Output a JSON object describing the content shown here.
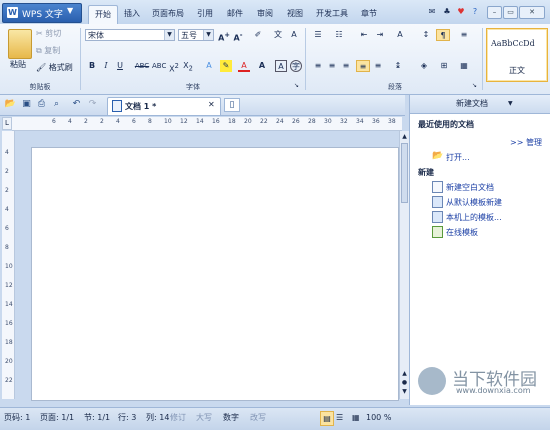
{
  "app": {
    "name": "WPS 文字",
    "logo": "W"
  },
  "tabs": [
    {
      "label": "开始",
      "active": true
    },
    {
      "label": "插入"
    },
    {
      "label": "页面布局"
    },
    {
      "label": "引用"
    },
    {
      "label": "邮件"
    },
    {
      "label": "审阅"
    },
    {
      "label": "视图"
    },
    {
      "label": "开发工具"
    },
    {
      "label": "章节"
    }
  ],
  "ribbon": {
    "clipboard": {
      "paste": "粘贴",
      "cut": "剪切",
      "copy": "复制",
      "format_painter": "格式刷",
      "group": "剪贴板"
    },
    "font": {
      "family": "宋体",
      "size": "五号",
      "group": "字体"
    },
    "paragraph": {
      "group": "段落"
    },
    "style": {
      "preview": "AaBbCcDd",
      "name": "正文"
    }
  },
  "doc_tab": {
    "title": "文档 1 *"
  },
  "ruler": {
    "h_ticks": [
      "6",
      "4",
      "2",
      "2",
      "4",
      "6",
      "8",
      "10",
      "12",
      "14",
      "16",
      "18",
      "20",
      "22",
      "24",
      "26",
      "28",
      "30",
      "32",
      "34",
      "36",
      "38"
    ],
    "v_ticks": [
      "4",
      "2",
      "2",
      "4",
      "6",
      "8",
      "10",
      "12",
      "14",
      "16",
      "18",
      "20",
      "22"
    ]
  },
  "pane": {
    "title": "新建文档",
    "recent_header": "最近使用的文档",
    "manage": ">> 管理",
    "open": "打开...",
    "new_header": "新建",
    "items": [
      "新建空白文档",
      "从默认模板新建",
      "本机上的模板...",
      "在线模板"
    ]
  },
  "status": {
    "page": "页码: 1",
    "pages": "页面: 1/1",
    "section": "节: 1/1",
    "row": "行: 3",
    "col": "列: 14",
    "revise": "修订",
    "caps": "大写",
    "num": "数字",
    "overwrite": "改写",
    "zoom": "100 %"
  },
  "watermark": {
    "brand": "当下软件园",
    "url": "www.downxia.com"
  }
}
